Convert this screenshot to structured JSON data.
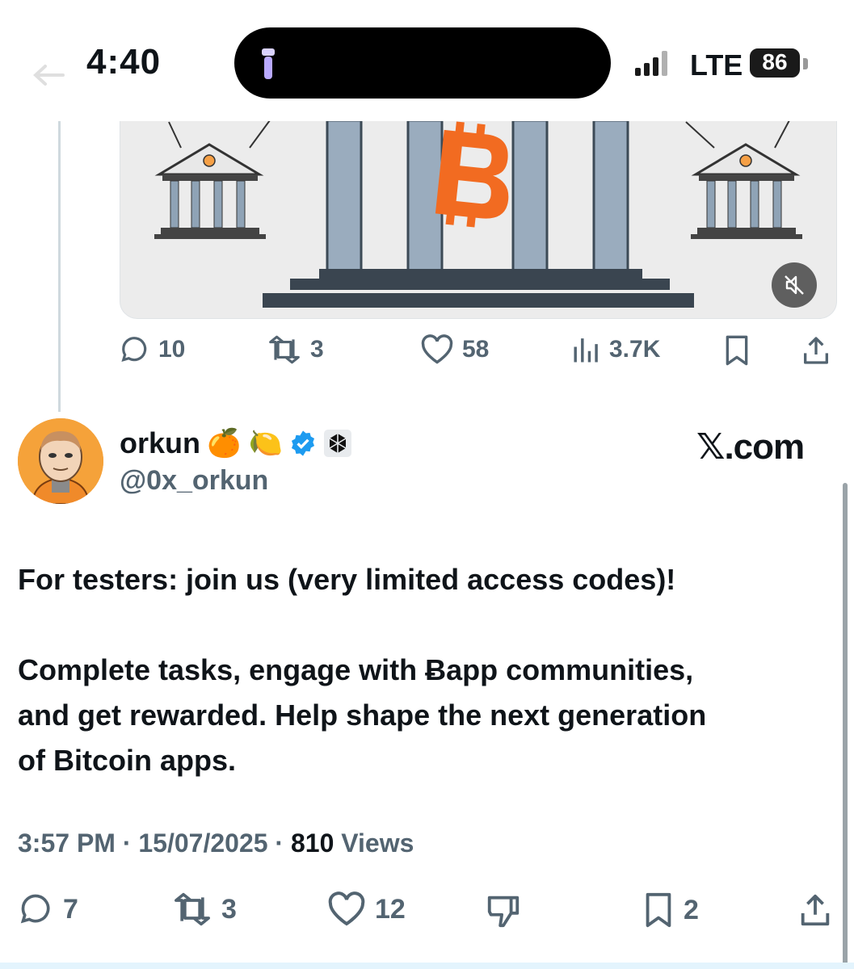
{
  "status_bar": {
    "time": "4:40",
    "network": "LTE",
    "battery": "86"
  },
  "previous_tweet": {
    "actions": {
      "replies": "10",
      "reposts": "3",
      "likes": "58",
      "views": "3.7K"
    }
  },
  "tweet": {
    "author": {
      "display_name": "orkun",
      "emojis": "🍊 🍋",
      "handle": "@0x_orkun"
    },
    "watermark": "𝕏.com",
    "paragraph_1": "For testers: join us (very limited access codes)!",
    "paragraph_2_line_1": "Complete tasks, engage with Ƀapp communities,",
    "paragraph_2_line_2": "and get rewarded. Help shape the next generation",
    "paragraph_2_line_3": "of Bitcoin apps.",
    "time": "3:57 PM",
    "date": "15/07/2025",
    "views_count": "810",
    "views_label": "Views",
    "actions": {
      "replies": "7",
      "reposts": "3",
      "likes": "12",
      "bookmarks": "2"
    }
  },
  "colors": {
    "text": "#0f1419",
    "secondary": "#536471",
    "verified": "#1d9bf0",
    "bitcoin": "#f26b21"
  }
}
